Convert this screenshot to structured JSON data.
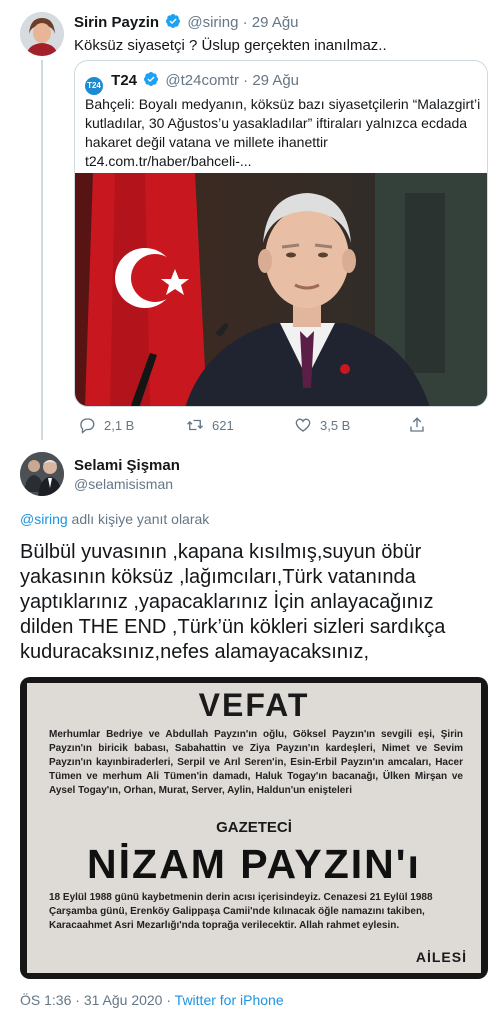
{
  "tweet1": {
    "author_name": "Sirin Payzin",
    "handle": "@siring",
    "date": "29 Ağu",
    "text": "Köksüz siyasetçi ? Üslup gerçekten inanılmaz..",
    "quote": {
      "logo": "T24",
      "author_name": "T24",
      "handle": "@t24comtr",
      "date": "29 Ağu",
      "text": "Bahçeli: Boyalı medyanın, köksüz bazı siyasetçilerin “Malazgirt’i kutladılar, 30 Ağustos’u yasakladılar” iftiraları yalnızca ecdada hakaret değil vatana ve millete ihanettir t24.com.tr/haber/bahceli-...",
      "image_icon": "photo-of-speaker-at-podium"
    },
    "actions": {
      "reply_count": "2,1 B",
      "retweet_count": "621",
      "like_count": "3,5 B"
    }
  },
  "tweet2": {
    "author_name": "Selami Şişman",
    "handle": "@selamisisman",
    "reply_to_prefix": "@siring",
    "reply_to_suffix": " adlı kişiye yanıt olarak",
    "text": "Bülbül yuvasının ,kapana kısılmış,suyun öbür yakasının köksüz ,lağımcıları,Türk vatanında yaptıklarınız ,yapacaklarınız İçin anlayacağınız dilden THE END ,Türk’ün kökleri sizleri sardıkça kuduracaksınız,nefes alamayacaksınız,",
    "notice": {
      "heading": "VEFAT",
      "paragraph": "Merhumlar Bedriye ve Abdullah Payzın'ın oğlu, Göksel Payzın'ın sevgili eşi, Şirin Payzın'ın biricik babası, Sabahattin ve Ziya Payzın'ın kardeşleri, Nimet ve Sevim Payzın'ın kayınbiraderleri, Serpil ve Arıl Seren'in, Esin-Erbil Payzın'ın amcaları, Hacer Tümen ve merhum Ali Tümen'in damadı, Haluk Togay'ın bacanağı, Ülken Mirşan ve Aysel Togay'ın, Orhan, Murat, Server, Aylin, Haldun'un enişteleri",
      "profession": "GAZETECİ",
      "name": "NİZAM PAYZIN'ı",
      "paragraph2": "18 Eylül 1988 günü kaybetmenin derin acısı içerisindeyiz. Cenazesi 21 Eylül 1988 Çarşamba günü, Erenköy Galippaşa Camii'nde kılınacak öğle namazını takiben, Karacaahmet Asri Mezarlığı'nda toprağa verilecektir. Allah rahmet eylesin.",
      "signature": "AİLESİ"
    },
    "time": "ÖS 1:36",
    "date": "31 Ağu 2020",
    "separator": " · ",
    "source": "Twitter for iPhone"
  }
}
